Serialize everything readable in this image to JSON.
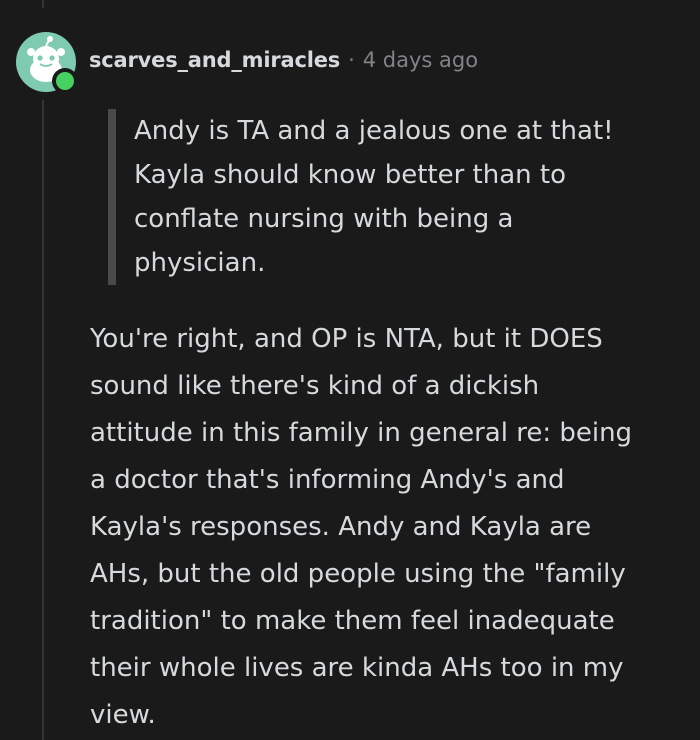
{
  "comment": {
    "username": "scarves_and_miracles",
    "separator": "·",
    "timestamp": "4 days ago",
    "avatar_icon": "snoo-avatar-icon",
    "online_indicator_color": "#46d160",
    "avatar_color": "#7ecbb2",
    "quote_lines": [
      "Andy is TA and a jealous one at that!",
      "Kayla should know better than to",
      "conflate nursing with being a",
      "physician."
    ],
    "body_lines": [
      "You're right, and OP is NTA, but it DOES",
      "sound like there's kind of a dickish",
      "attitude in this family in general re: being",
      "a doctor that's informing Andy's and",
      "Kayla's responses. Andy and Kayla are",
      "AHs, but the old people using the \"family",
      "tradition\" to make them feel inadequate",
      "their whole lives are kinda AHs too in my",
      "view."
    ]
  }
}
